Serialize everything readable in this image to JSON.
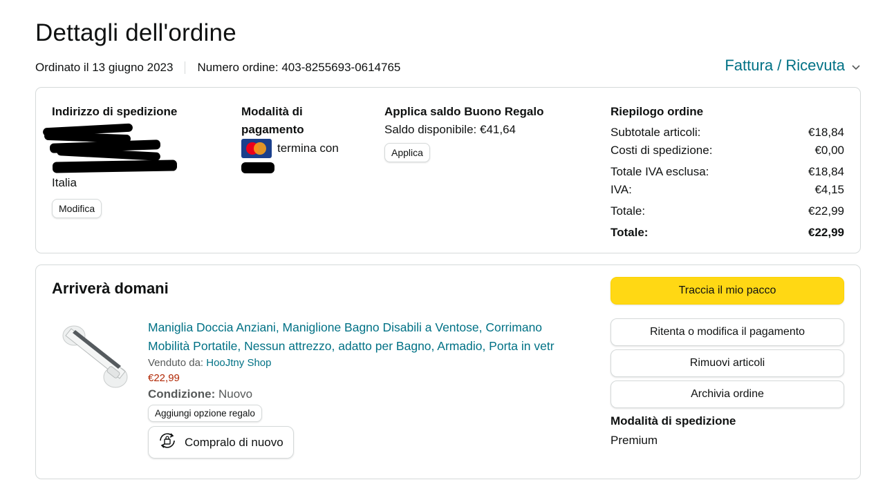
{
  "header": {
    "title": "Dettagli dell'ordine",
    "ordered_on": "Ordinato il 13 giugno 2023",
    "order_number": "Numero ordine: 403-8255693-0614765",
    "invoice_label": "Fattura / Ricevuta",
    "invoice_icon": "chevron-down-icon"
  },
  "shipping_address": {
    "heading": "Indirizzo di spedizione",
    "country": "Italia",
    "edit_label": "Modifica"
  },
  "payment": {
    "heading": "Modalità di pagamento",
    "card_brand": "MasterCard",
    "ending_text": "termina con"
  },
  "gift_balance": {
    "heading": "Applica saldo Buono Regalo",
    "available": "Saldo disponibile: €41,64",
    "apply_label": "Applica"
  },
  "summary": {
    "heading": "Riepilogo ordine",
    "rows": [
      {
        "label": "Subtotale articoli:",
        "value": "€18,84"
      },
      {
        "label": "Costi di spedizione:",
        "value": "€0,00"
      },
      {
        "label": "Totale IVA esclusa:",
        "value": "€18,84"
      },
      {
        "label": "IVA:",
        "value": "€4,15"
      },
      {
        "label": "Totale:",
        "value": "€22,99"
      },
      {
        "label": "Totale:",
        "value": "€22,99"
      }
    ]
  },
  "shipment": {
    "status": "Arriverà domani",
    "product": {
      "title_line1": "Maniglia Doccia Anziani, Maniglione Bagno Disabili a Ventose, Corrimano",
      "title_line2": "Mobilità Portatile, Nessun attrezzo, adatto per Bagno, Armadio, Porta in vetr",
      "sold_by_label": "Venduto da:",
      "seller": "HooJtny Shop",
      "price": "€22,99",
      "condition_label": "Condizione:",
      "condition_value": "Nuovo",
      "gift_option_label": "Aggiungi opzione regalo",
      "buy_again_label": "Compralo di nuovo"
    },
    "actions": {
      "track": "Traccia il mio pacco",
      "retry_payment": "Ritenta o modifica il pagamento",
      "remove_items": "Rimuovi articoli",
      "archive": "Archivia ordine"
    },
    "shipping_mode_heading": "Modalità di spedizione",
    "shipping_mode_value": "Premium"
  },
  "colors": {
    "link": "#007185",
    "price": "#b12704",
    "primary_button": "#ffd814",
    "border": "#d5d9d9"
  }
}
